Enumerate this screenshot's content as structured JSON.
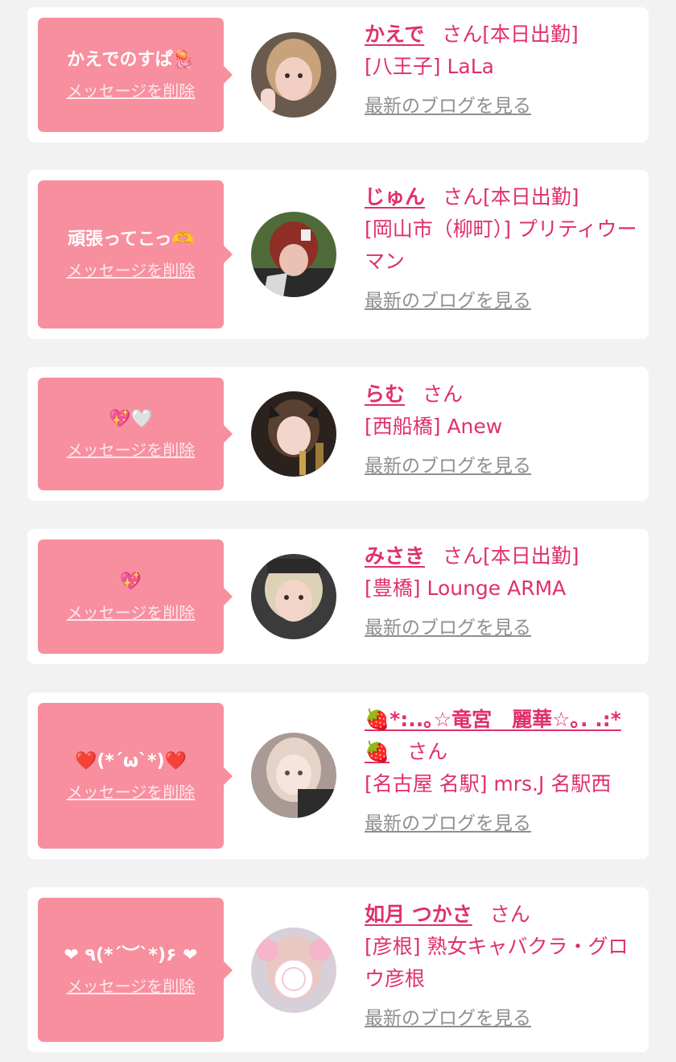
{
  "entries": [
    {
      "message": "かえでのすぱ🪼",
      "delete_label": "メッセージを削除",
      "name": "かえで",
      "honorific": "さん",
      "status": "[本日出勤]",
      "shop": "[八王子] LaLa",
      "blog_label": "最新のブログを見る"
    },
    {
      "message": "頑張ってこっ🫶",
      "delete_label": "メッセージを削除",
      "name": "じゅん",
      "honorific": "さん",
      "status": "[本日出勤]",
      "shop": "[岡山市（柳町）] プリティウーマン",
      "blog_label": "最新のブログを見る"
    },
    {
      "message": "💖🤍",
      "delete_label": "メッセージを削除",
      "name": "らむ",
      "honorific": "さん",
      "status": "",
      "shop": "[西船橋] Anew",
      "blog_label": "最新のブログを見る"
    },
    {
      "message": "💖",
      "delete_label": "メッセージを削除",
      "name": "みさき",
      "honorific": "さん",
      "status": "[本日出勤]",
      "shop": "[豊橋] Lounge ARMA",
      "blog_label": "最新のブログを見る"
    },
    {
      "message": "❤️(*´ω`*)❤️",
      "delete_label": "メッセージを削除",
      "name": "🍓*:..｡☆竜宮　麗華☆｡. .:*🍓",
      "honorific": "さん",
      "status": "",
      "shop": "[名古屋 名駅] mrs.J 名駅西",
      "blog_label": "最新のブログを見る"
    },
    {
      "message": "❤ ٩(*´︶`*)۶ ❤",
      "delete_label": "メッセージを削除",
      "name": "如月 つかさ",
      "honorific": "さん",
      "status": "",
      "shop": "[彦根] 熟女キャバクラ・グロウ彦根",
      "blog_label": "最新のブログを見る"
    }
  ],
  "colors": {
    "page_bg": "#f2f2f2",
    "card_bg": "#ffffff",
    "bubble_bg": "#f78f9f",
    "accent_pink": "#e0306a",
    "link_gray": "#8f8f8f"
  }
}
